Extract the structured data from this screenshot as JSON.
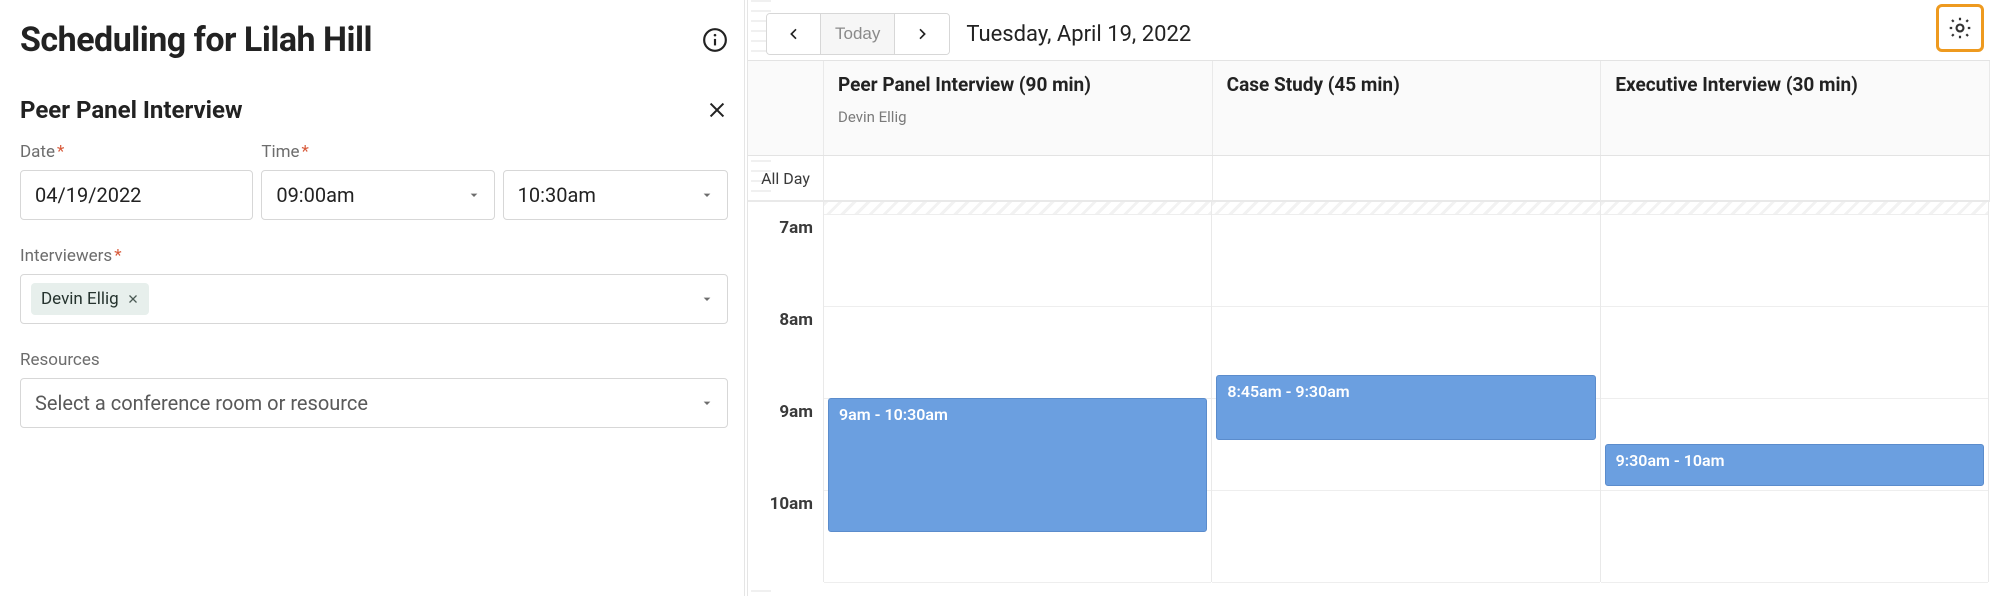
{
  "header": {
    "title": "Scheduling for Lilah Hill"
  },
  "panel": {
    "title": "Peer Panel Interview",
    "date_label": "Date",
    "date_value": "04/19/2022",
    "time_label": "Time",
    "start_time": "09:00am",
    "end_time": "10:30am",
    "interviewers_label": "Interviewers",
    "interviewers": [
      {
        "name": "Devin Ellig"
      }
    ],
    "resources_label": "Resources",
    "resources_placeholder": "Select a conference room or resource"
  },
  "calendar": {
    "today_label": "Today",
    "date_text": "Tuesday, April 19, 2022",
    "allday_label": "All Day",
    "hours": [
      "7am",
      "8am",
      "9am",
      "10am"
    ],
    "hour_height": 92,
    "lanes": [
      {
        "title": "Peer Panel Interview (90 min)",
        "sub": "Devin Ellig"
      },
      {
        "title": "Case Study (45 min)",
        "sub": ""
      },
      {
        "title": "Executive Interview (30 min)",
        "sub": ""
      }
    ],
    "events": [
      {
        "lane": 0,
        "label": "9am - 10:30am",
        "start_hour_offset": 2.0,
        "duration_hours": 1.5
      },
      {
        "lane": 1,
        "label": "8:45a - 9:30am",
        "display_label": "8:45am - 9:30am",
        "start_hour_offset": 1.75,
        "duration_hours": 0.75
      },
      {
        "lane": 2,
        "label": "9:30am - 10am",
        "start_hour_offset": 2.5,
        "duration_hours": 0.5
      }
    ]
  },
  "colors": {
    "accent": "#6b9fe0",
    "highlight": "#ee9a1f"
  }
}
